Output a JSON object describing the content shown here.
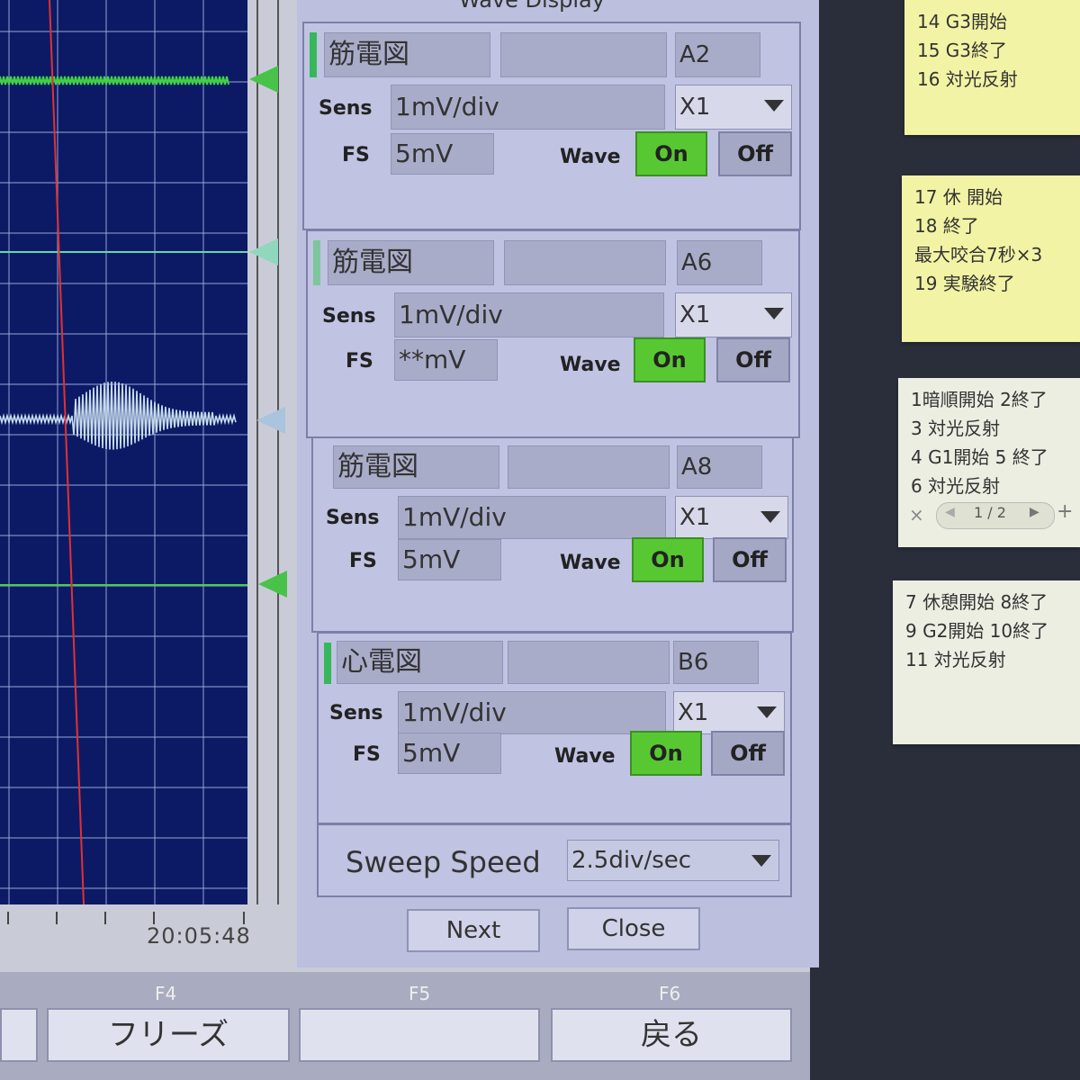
{
  "dialog": {
    "title": "Wave Display",
    "channels": [
      {
        "name": "筋電図",
        "channel": "A2",
        "sens_label": "Sens",
        "sens": "1mV/div",
        "multiplier": "X1",
        "fs_label": "FS",
        "fs": "5mV",
        "wave_label": "Wave",
        "on": "On",
        "off": "Off"
      },
      {
        "name": "筋電図",
        "channel": "A6",
        "sens_label": "Sens",
        "sens": "1mV/div",
        "multiplier": "X1",
        "fs_label": "FS",
        "fs": "**mV",
        "wave_label": "Wave",
        "on": "On",
        "off": "Off"
      },
      {
        "name": "筋電図",
        "channel": "A8",
        "sens_label": "Sens",
        "sens": "1mV/div",
        "multiplier": "X1",
        "fs_label": "FS",
        "fs": "5mV",
        "wave_label": "Wave",
        "on": "On",
        "off": "Off"
      },
      {
        "name": "心電図",
        "channel": "B6",
        "sens_label": "Sens",
        "sens": "1mV/div",
        "multiplier": "X1",
        "fs_label": "FS",
        "fs": "5mV",
        "wave_label": "Wave",
        "on": "On",
        "off": "Off"
      }
    ],
    "sweep_label": "Sweep Speed",
    "sweep_value": "2.5div/sec",
    "next": "Next",
    "close": "Close"
  },
  "wave": {
    "timestamp": "20:05:48"
  },
  "function_bar": {
    "f4": "F4",
    "f4_label": "フリーズ",
    "f5": "F5",
    "f5_label": "",
    "f6": "F6",
    "f6_label": "戻る"
  },
  "notes": {
    "note1": [
      "14 G3開始",
      "15 G3終了",
      "16 対光反射"
    ],
    "note2": [
      "17 休 開始",
      "18 終了",
      "最大咬合7秒×3",
      "19 実験終了"
    ],
    "note3": [
      "1暗順開始 2終了",
      "3 対光反射",
      "4 G1開始 5 終了",
      "6 対光反射"
    ],
    "note3_page": "1 / 2",
    "note4": [
      "7 休憩開始 8終了",
      "9 G2開始 10終了",
      "11 対光反射"
    ]
  },
  "colors": {
    "screen": "#0c1a66",
    "emg_trace": "#41d441",
    "teal_trace": "#63d9b0",
    "cursor": "#e23030",
    "on_button": "#58c832"
  }
}
